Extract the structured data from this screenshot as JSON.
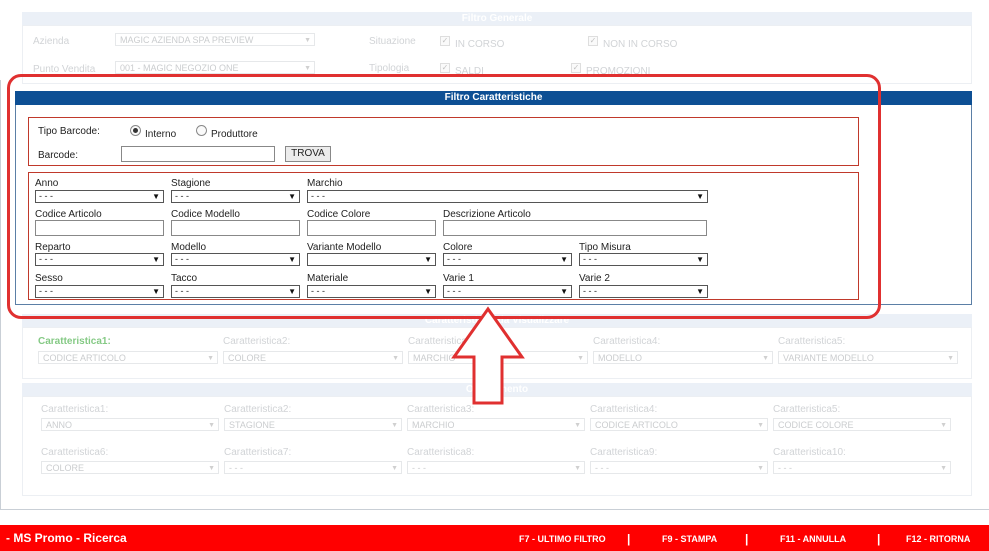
{
  "filtro_generale": {
    "title": "Filtro Generale",
    "azienda_label": "Azienda",
    "azienda_value": "MAGIC AZIENDA SPA PREVIEW",
    "punto_vendita_label": "Punto Vendita",
    "punto_vendita_value": "001 - MAGIC NEGOZIO ONE",
    "situazione_label": "Situazione",
    "in_corso": "IN CORSO",
    "non_in_corso": "NON IN CORSO",
    "tipologia_label": "Tipologia",
    "saldi": "SALDI",
    "promozioni": "PROMOZIONI"
  },
  "filtro_caratteristiche": {
    "title": "Filtro Caratteristiche",
    "tipo_barcode_label": "Tipo Barcode:",
    "radio_interno": "Interno",
    "radio_produttore": "Produttore",
    "barcode_label": "Barcode:",
    "barcode_value": "",
    "trova": "TROVA",
    "placeholder_option": "- - -",
    "fields": {
      "anno": "Anno",
      "stagione": "Stagione",
      "marchio": "Marchio",
      "codice_articolo": "Codice Articolo",
      "codice_modello": "Codice Modello",
      "codice_colore": "Codice Colore",
      "descrizione_articolo": "Descrizione Articolo",
      "reparto": "Reparto",
      "modello": "Modello",
      "variante_modello": "Variante Modello",
      "colore": "Colore",
      "tipo_misura": "Tipo Misura",
      "sesso": "Sesso",
      "tacco": "Tacco",
      "materiale": "Materiale",
      "varie1": "Varie 1",
      "varie2": "Varie 2"
    }
  },
  "visualizzare": {
    "title_partial": "Caratteristiche da Visualizzare",
    "cols": [
      {
        "label": "Caratteristica1:",
        "value": "CODICE ARTICOLO"
      },
      {
        "label": "Caratteristica2:",
        "value": "COLORE"
      },
      {
        "label": "Caratteristica3:",
        "value": "MARCHIO"
      },
      {
        "label": "Caratteristica4:",
        "value": "MODELLO"
      },
      {
        "label": "Caratteristica5:",
        "value": "VARIANTE MODELLO"
      }
    ]
  },
  "ordinamento": {
    "title_partial": "Ordinamento",
    "row1": [
      {
        "label": "Caratteristica1:",
        "value": "ANNO"
      },
      {
        "label": "Caratteristica2:",
        "value": "STAGIONE"
      },
      {
        "label": "Caratteristica3:",
        "value": "MARCHIO"
      },
      {
        "label": "Caratteristica4:",
        "value": "CODICE ARTICOLO"
      },
      {
        "label": "Caratteristica5:",
        "value": "CODICE COLORE"
      }
    ],
    "row2": [
      {
        "label": "Caratteristica6:",
        "value": "COLORE"
      },
      {
        "label": "Caratteristica7:",
        "value": "- - -"
      },
      {
        "label": "Caratteristica8:",
        "value": "- - -"
      },
      {
        "label": "Caratteristica9:",
        "value": "- - -"
      },
      {
        "label": "Caratteristica10:",
        "value": "- - -"
      }
    ]
  },
  "footer": {
    "title": "- MS Promo - Ricerca",
    "f7": "F7 - ULTIMO FILTRO",
    "f9": "F9 - STAMPA",
    "f11": "F11 - ANNULLA",
    "f12": "F12 - RITORNA",
    "sep": "|"
  },
  "colors": {
    "header_blue": "#0d4f94",
    "footer_red": "#ff0000",
    "highlight_red": "#e03030",
    "active_label_green": "#5cb85c"
  }
}
